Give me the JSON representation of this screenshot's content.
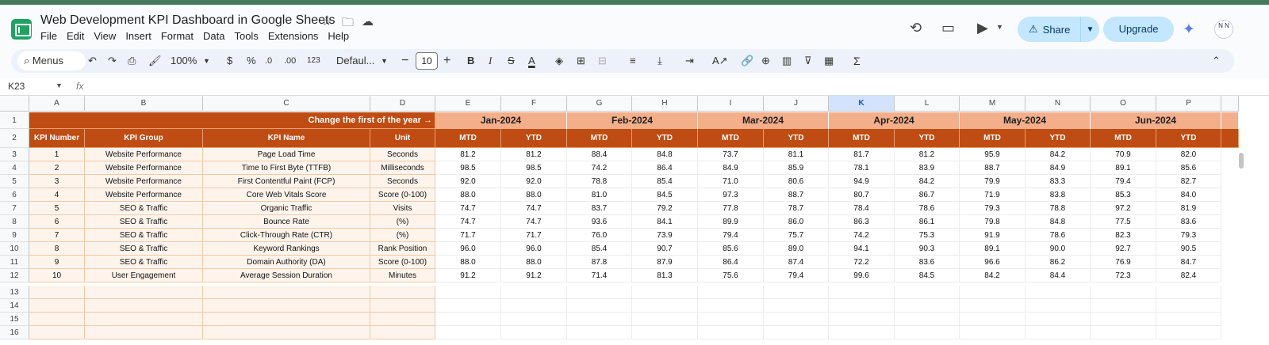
{
  "app": {
    "doc_title": "Web Development KPI Dashboard in Google Sheets",
    "menus": [
      "File",
      "Edit",
      "View",
      "Insert",
      "Format",
      "Data",
      "Tools",
      "Extensions",
      "Help"
    ],
    "share_label": "Share",
    "upgrade_label": "Upgrade",
    "avatar_text": "N N"
  },
  "toolbar": {
    "menus_label": "Menus",
    "zoom": "100%",
    "currency": "$",
    "percent": "%",
    "dec_dec": ".0",
    "inc_dec": ".00",
    "number_format": "123",
    "font_name": "Defaul...",
    "font_size": "10",
    "bold": "B",
    "italic": "I",
    "text_color": "A",
    "sigma": "Σ"
  },
  "formula_bar": {
    "name_box": "K23",
    "fx": "fx"
  },
  "grid": {
    "selected_column": "K",
    "columns": [
      "A",
      "B",
      "C",
      "D",
      "E",
      "F",
      "G",
      "H",
      "I",
      "J",
      "K",
      "L",
      "M",
      "N",
      "O",
      "P"
    ],
    "row_numbers": [
      "1",
      "2",
      "3",
      "4",
      "5",
      "6",
      "7",
      "8",
      "9",
      "10",
      "11",
      "12",
      "13",
      "14",
      "15",
      "16"
    ],
    "note": "Change the first of the year →",
    "headers": [
      "KPI Number",
      "KPI Group",
      "KPI Name",
      "Unit"
    ],
    "months": [
      "Jan-2024",
      "Feb-2024",
      "Mar-2024",
      "Apr-2024",
      "May-2024",
      "Jun-2024"
    ],
    "mtd_label": "MTD",
    "ytd_label": "YTD",
    "rows": [
      {
        "num": "1",
        "group": "Website Performance",
        "name": "Page Load Time",
        "unit": "Seconds",
        "vals": [
          "81.2",
          "81.2",
          "88.4",
          "84.8",
          "73.7",
          "81.1",
          "81.7",
          "81.2",
          "95.9",
          "84.2",
          "70.9",
          "82.0"
        ]
      },
      {
        "num": "2",
        "group": "Website Performance",
        "name": "Time to First Byte (TTFB)",
        "unit": "Milliseconds",
        "vals": [
          "98.5",
          "98.5",
          "74.2",
          "86.4",
          "84.9",
          "85.9",
          "78.1",
          "83.9",
          "88.7",
          "84.9",
          "89.1",
          "85.6"
        ]
      },
      {
        "num": "3",
        "group": "Website Performance",
        "name": "First Contentful Paint (FCP)",
        "unit": "Seconds",
        "vals": [
          "92.0",
          "92.0",
          "78.8",
          "85.4",
          "71.0",
          "80.6",
          "94.9",
          "84.2",
          "79.9",
          "83.3",
          "79.4",
          "82.7"
        ]
      },
      {
        "num": "4",
        "group": "Website Performance",
        "name": "Core Web Vitals Score",
        "unit": "Score (0-100)",
        "vals": [
          "88.0",
          "88.0",
          "81.0",
          "84.5",
          "97.3",
          "88.7",
          "80.7",
          "86.7",
          "71.9",
          "83.8",
          "85.3",
          "84.0"
        ]
      },
      {
        "num": "5",
        "group": "SEO & Traffic",
        "name": "Organic Traffic",
        "unit": "Visits",
        "vals": [
          "74.7",
          "74.7",
          "83.7",
          "79.2",
          "77.8",
          "78.7",
          "78.4",
          "78.6",
          "79.3",
          "78.8",
          "97.2",
          "81.9"
        ]
      },
      {
        "num": "6",
        "group": "SEO & Traffic",
        "name": "Bounce Rate",
        "unit": "(%)",
        "vals": [
          "74.7",
          "74.7",
          "93.6",
          "84.1",
          "89.9",
          "86.0",
          "86.3",
          "86.1",
          "79.8",
          "84.8",
          "77.5",
          "83.6"
        ]
      },
      {
        "num": "7",
        "group": "SEO & Traffic",
        "name": "Click-Through Rate (CTR)",
        "unit": "(%)",
        "vals": [
          "71.7",
          "71.7",
          "76.0",
          "73.9",
          "79.4",
          "75.7",
          "74.2",
          "75.3",
          "91.9",
          "78.6",
          "82.3",
          "79.3"
        ]
      },
      {
        "num": "8",
        "group": "SEO & Traffic",
        "name": "Keyword Rankings",
        "unit": "Rank Position",
        "vals": [
          "96.0",
          "96.0",
          "85.4",
          "90.7",
          "85.6",
          "89.0",
          "94.1",
          "90.3",
          "89.1",
          "90.0",
          "92.7",
          "90.5"
        ]
      },
      {
        "num": "9",
        "group": "SEO & Traffic",
        "name": "Domain Authority (DA)",
        "unit": "Score (0-100)",
        "vals": [
          "88.0",
          "88.0",
          "87.8",
          "87.9",
          "86.4",
          "87.4",
          "72.2",
          "83.6",
          "96.6",
          "86.2",
          "76.9",
          "84.7"
        ]
      },
      {
        "num": "10",
        "group": "User Engagement",
        "name": "Average Session Duration",
        "unit": "Minutes",
        "vals": [
          "91.2",
          "91.2",
          "71.4",
          "81.3",
          "75.6",
          "79.4",
          "99.6",
          "84.5",
          "84.2",
          "84.4",
          "72.3",
          "82.4"
        ]
      }
    ]
  }
}
